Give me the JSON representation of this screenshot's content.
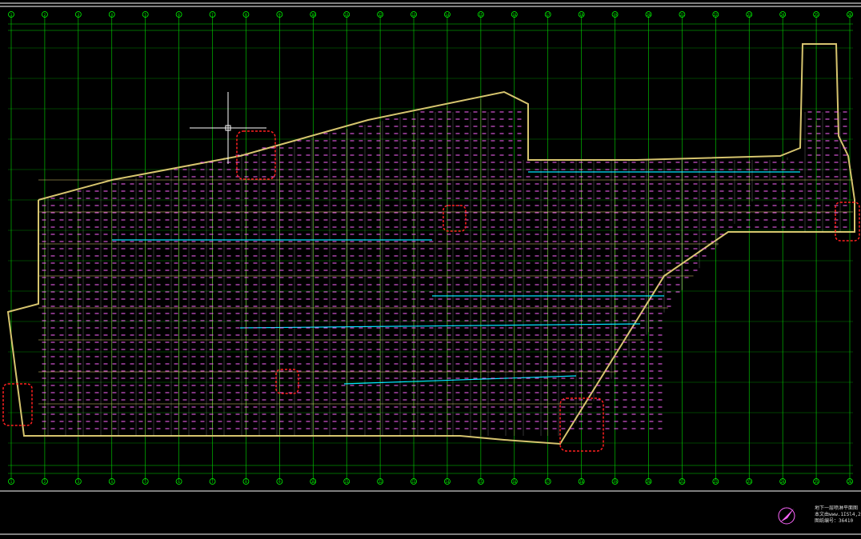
{
  "drawing": {
    "title_line1": "地下一层喷淋平面图 1:100",
    "title_line2": "本文由www.1ISl4,27-",
    "title_line3": "图纸编号：36410"
  },
  "colors": {
    "background": "#000000",
    "axis": "#00ff00",
    "wall": "#d6c46e",
    "sprinkler": "#ff66ff",
    "pipe": "#ffffff",
    "cyan_pipe": "#00e5ff",
    "revision_cloud": "#ff2020",
    "frame": "#ffffff"
  },
  "axes": {
    "column_marks": [
      "1",
      "2",
      "3",
      "4",
      "5",
      "6",
      "7",
      "8",
      "9",
      "10",
      "11",
      "12",
      "13",
      "14",
      "15",
      "16",
      "17",
      "18",
      "19",
      "20",
      "21",
      "22",
      "23",
      "24",
      "25",
      "26"
    ]
  },
  "icons": {
    "north_arrow": "north-arrow-icon",
    "ucs_cursor": "crosshair-cursor-icon"
  }
}
